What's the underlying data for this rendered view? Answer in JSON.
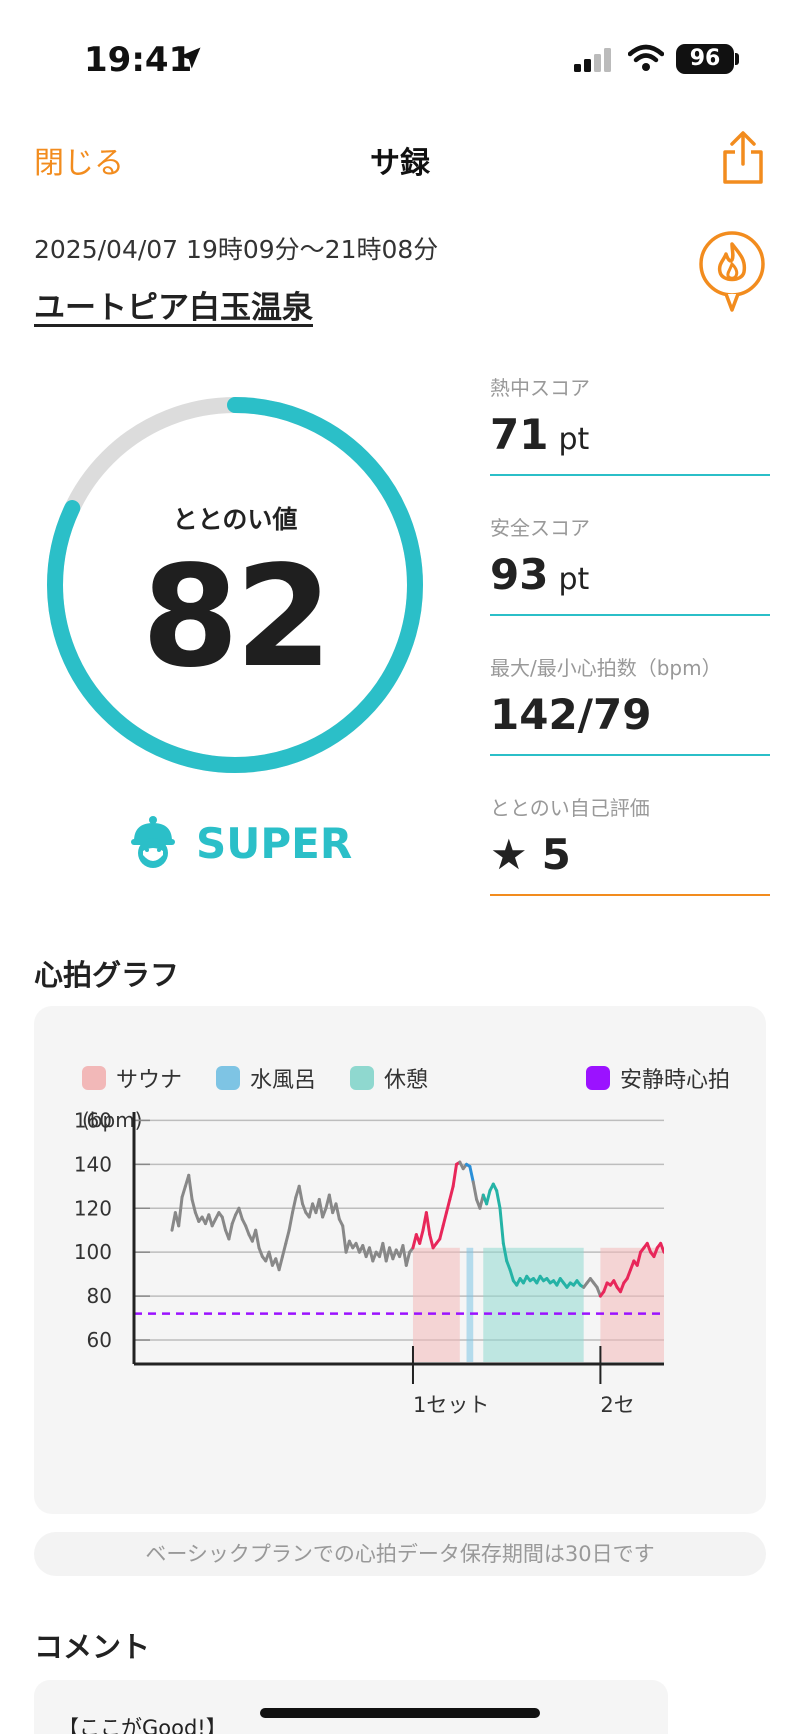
{
  "status": {
    "time": "19:41",
    "battery": "96"
  },
  "nav": {
    "close_label": "閉じる",
    "title": "サ録"
  },
  "session": {
    "datetime": "2025/04/07 19時09分〜21時08分",
    "place": "ユートピア白玉温泉"
  },
  "gauge": {
    "label": "ととのい値",
    "value": "82",
    "fraction": 0.82,
    "rank": "SUPER",
    "accent": "#2bbfc8"
  },
  "metrics": [
    {
      "label": "熱中スコア",
      "value": "71",
      "unit": "pt"
    },
    {
      "label": "安全スコア",
      "value": "93",
      "unit": "pt"
    },
    {
      "label": "最大/最小心拍数（bpm）",
      "value": "142/79",
      "unit": ""
    },
    {
      "label": "ととのい自己評価",
      "star": "★",
      "value": "5",
      "unit": ""
    }
  ],
  "graph": {
    "title": "心拍グラフ",
    "legend": [
      {
        "label": "サウナ",
        "color": "#f2b8b8"
      },
      {
        "label": "水風呂",
        "color": "#7ec4e4"
      },
      {
        "label": "休憩",
        "color": "#8fd8cf"
      },
      {
        "label": "安静時心拍",
        "color": "#9b12ff"
      }
    ],
    "unit": "(bpm)",
    "set_labels": [
      "1セット",
      "2セ"
    ]
  },
  "chart_data": {
    "type": "line",
    "ylabel": "(bpm)",
    "ylim": [
      50,
      162
    ],
    "y_ticks": [
      60,
      80,
      100,
      120,
      140,
      160
    ],
    "resting_hr": 72,
    "x_labels": [
      "1セット",
      "2セ"
    ],
    "series": [
      {
        "name": "",
        "color": "#888888",
        "x": [
          0,
          2,
          4,
          6,
          8,
          10,
          12,
          14,
          16,
          18,
          20,
          22,
          24,
          26,
          28,
          30,
          32,
          34,
          36,
          38,
          40,
          42,
          44,
          46,
          48,
          50,
          52,
          54,
          56,
          58,
          60,
          62,
          64,
          66,
          68,
          70,
          72,
          74,
          76,
          78,
          80,
          82,
          84,
          86,
          88,
          90,
          92,
          94,
          96,
          98,
          100,
          102,
          104,
          106,
          108,
          110,
          112,
          114,
          116,
          118,
          120,
          122,
          124,
          126,
          128,
          130,
          132,
          134,
          136,
          138,
          140,
          142,
          144,
          146,
          148,
          150,
          152,
          154,
          156,
          158,
          160,
          162,
          164,
          166,
          168,
          170,
          172,
          174,
          176,
          178,
          180,
          182,
          184,
          186,
          188,
          190,
          192,
          194,
          196,
          198,
          200,
          202,
          204,
          206,
          208,
          210,
          212,
          214,
          216,
          218,
          220,
          222,
          224,
          226,
          228,
          230,
          232,
          234,
          236,
          238,
          240,
          242,
          244,
          246,
          248,
          250,
          252,
          254,
          256,
          258,
          260,
          262,
          264,
          266,
          268,
          270,
          272,
          274,
          276,
          278,
          280,
          282,
          284,
          286,
          288,
          290,
          292,
          294
        ],
        "y": [
          110,
          118,
          112,
          125,
          130,
          135,
          124,
          118,
          114,
          116,
          113,
          117,
          112,
          115,
          118,
          116,
          110,
          106,
          113,
          117,
          120,
          115,
          112,
          108,
          105,
          110,
          102,
          98,
          96,
          100,
          94,
          97,
          92,
          98,
          104,
          110,
          118,
          125,
          130,
          122,
          118,
          116,
          122,
          118,
          124,
          116,
          120,
          126,
          118,
          122,
          115,
          112,
          100,
          105,
          102,
          104,
          100,
          103,
          98,
          102,
          96,
          100,
          98,
          104,
          96,
          102,
          97,
          101,
          98,
          103,
          94,
          100,
          102,
          108,
          104,
          110,
          118,
          108,
          102,
          104,
          106,
          112,
          118,
          124,
          130,
          140,
          141,
          138,
          140,
          139,
          132,
          124,
          120,
          126,
          122,
          128,
          131,
          128,
          120,
          104,
          96,
          92,
          87,
          85,
          88,
          86,
          89,
          87,
          88,
          86,
          89,
          87,
          88,
          86,
          87,
          85,
          88,
          86,
          84,
          86,
          85,
          87,
          85,
          84,
          86,
          88,
          86,
          84,
          80,
          82,
          86,
          85,
          87,
          84,
          82,
          86,
          88,
          92,
          96,
          94,
          100,
          102,
          104,
          100,
          98,
          102,
          104,
          100
        ]
      }
    ],
    "phases": [
      {
        "name": "サウナ",
        "from": 144,
        "to": 172
      },
      {
        "name": "水風呂",
        "from": 176,
        "to": 180
      },
      {
        "name": "休憩",
        "from": 186,
        "to": 246
      },
      {
        "name": "サウナ",
        "from": 256,
        "to": 294
      }
    ]
  },
  "notice": "ベーシックプランでの心拍データ保存期間は30日です",
  "comment": {
    "title": "コメント",
    "text": "【ここがGood!】"
  }
}
